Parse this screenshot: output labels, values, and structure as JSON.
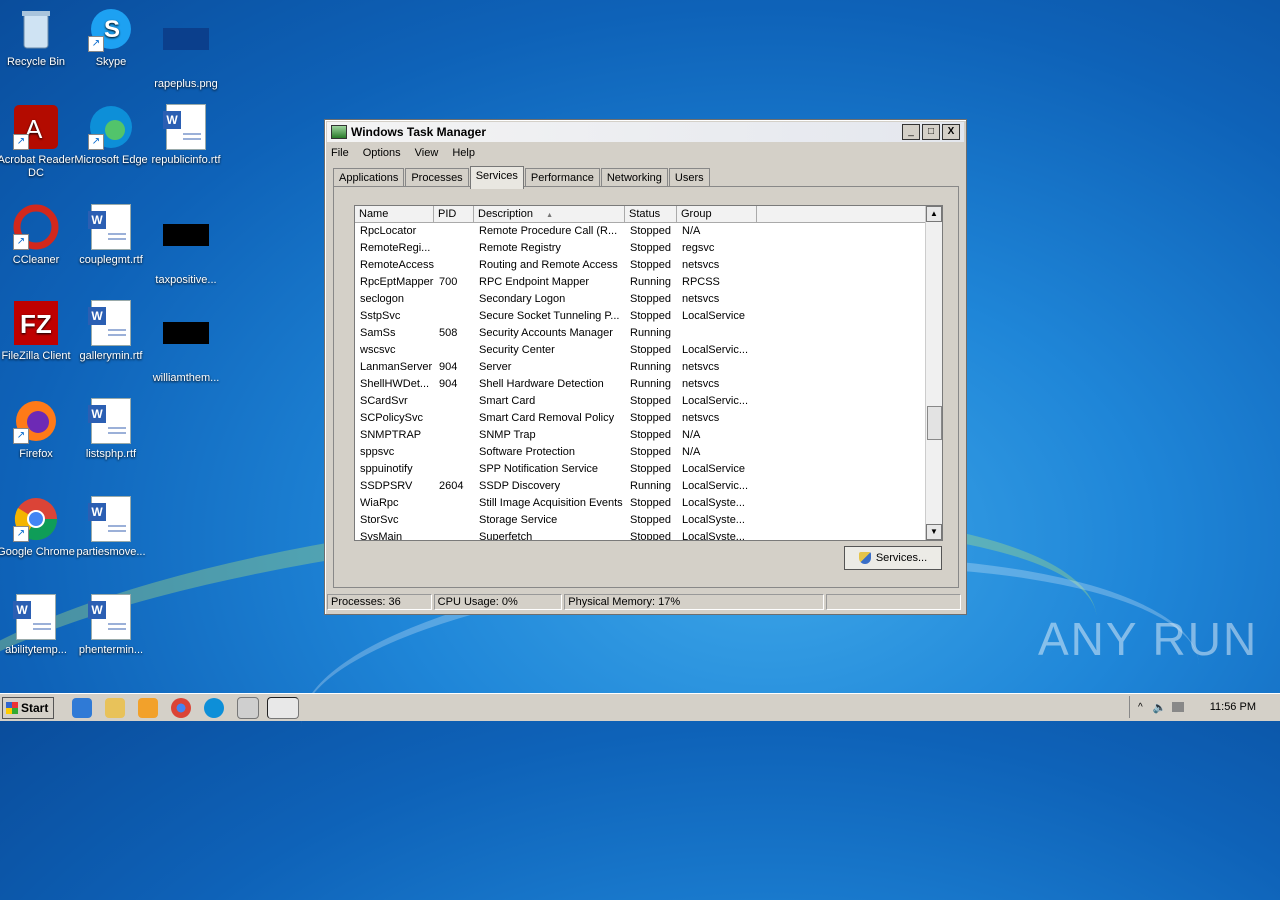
{
  "desktop_icons": [
    {
      "label": "Recycle Bin",
      "icon": "recycle-bin-icon"
    },
    {
      "label": "Skype",
      "icon": "skype-icon"
    },
    {
      "label": "rapeplus.png",
      "icon": "image-file-icon"
    },
    {
      "label": "Acrobat Reader DC",
      "icon": "acrobat-icon"
    },
    {
      "label": "Microsoft Edge",
      "icon": "edge-icon"
    },
    {
      "label": "republicinfo.rtf",
      "icon": "word-doc-icon"
    },
    {
      "label": "CCleaner",
      "icon": "ccleaner-icon"
    },
    {
      "label": "couplegmt.rtf",
      "icon": "word-doc-icon"
    },
    {
      "label": "taxpositive...",
      "icon": "black-file-icon"
    },
    {
      "label": "FileZilla Client",
      "icon": "filezilla-icon"
    },
    {
      "label": "gallerymin.rtf",
      "icon": "word-doc-icon"
    },
    {
      "label": "williamthem...",
      "icon": "black-file-icon"
    },
    {
      "label": "Firefox",
      "icon": "firefox-icon"
    },
    {
      "label": "listsphp.rtf",
      "icon": "word-doc-icon"
    },
    {
      "label": "Google Chrome",
      "icon": "chrome-icon"
    },
    {
      "label": "partiesmove...",
      "icon": "word-doc-icon"
    },
    {
      "label": "abilitytemp...",
      "icon": "word-doc-icon"
    },
    {
      "label": "phentermin...",
      "icon": "word-doc-icon"
    }
  ],
  "window": {
    "title": "Windows Task Manager",
    "minimize": "_",
    "maximize": "□",
    "close": "X"
  },
  "menu": [
    "File",
    "Options",
    "View",
    "Help"
  ],
  "tabs": [
    "Applications",
    "Processes",
    "Services",
    "Performance",
    "Networking",
    "Users"
  ],
  "active_tab": "Services",
  "columns": [
    "Name",
    "PID",
    "Description",
    "Status",
    "Group"
  ],
  "sort_indicator": "▲",
  "rows": [
    [
      "RpcLocator",
      "",
      "Remote Procedure Call (R...",
      "Stopped",
      "N/A"
    ],
    [
      "RemoteRegi...",
      "",
      "Remote Registry",
      "Stopped",
      "regsvc"
    ],
    [
      "RemoteAccess",
      "",
      "Routing and Remote Access",
      "Stopped",
      "netsvcs"
    ],
    [
      "RpcEptMapper",
      "700",
      "RPC Endpoint Mapper",
      "Running",
      "RPCSS"
    ],
    [
      "seclogon",
      "",
      "Secondary Logon",
      "Stopped",
      "netsvcs"
    ],
    [
      "SstpSvc",
      "",
      "Secure Socket Tunneling P...",
      "Stopped",
      "LocalService"
    ],
    [
      "SamSs",
      "508",
      "Security Accounts Manager",
      "Running",
      ""
    ],
    [
      "wscsvc",
      "",
      "Security Center",
      "Stopped",
      "LocalServic..."
    ],
    [
      "LanmanServer",
      "904",
      "Server",
      "Running",
      "netsvcs"
    ],
    [
      "ShellHWDet...",
      "904",
      "Shell Hardware Detection",
      "Running",
      "netsvcs"
    ],
    [
      "SCardSvr",
      "",
      "Smart Card",
      "Stopped",
      "LocalServic..."
    ],
    [
      "SCPolicySvc",
      "",
      "Smart Card Removal Policy",
      "Stopped",
      "netsvcs"
    ],
    [
      "SNMPTRAP",
      "",
      "SNMP Trap",
      "Stopped",
      "N/A"
    ],
    [
      "sppsvc",
      "",
      "Software Protection",
      "Stopped",
      "N/A"
    ],
    [
      "sppuinotify",
      "",
      "SPP Notification Service",
      "Stopped",
      "LocalService"
    ],
    [
      "SSDPSRV",
      "2604",
      "SSDP Discovery",
      "Running",
      "LocalServic..."
    ],
    [
      "WiaRpc",
      "",
      "Still Image Acquisition Events",
      "Stopped",
      "LocalSyste..."
    ],
    [
      "StorSvc",
      "",
      "Storage Service",
      "Stopped",
      "LocalSyste..."
    ],
    [
      "SysMain",
      "",
      "Superfetch",
      "Stopped",
      "LocalSyste..."
    ]
  ],
  "services_button": "Services...",
  "statusbar": {
    "processes": "Processes: 36",
    "cpu": "CPU Usage: 0%",
    "memory": "Physical Memory: 17%"
  },
  "taskbar": {
    "start": "Start",
    "clock": "11:56 PM"
  },
  "watermark": "ANY RUN"
}
